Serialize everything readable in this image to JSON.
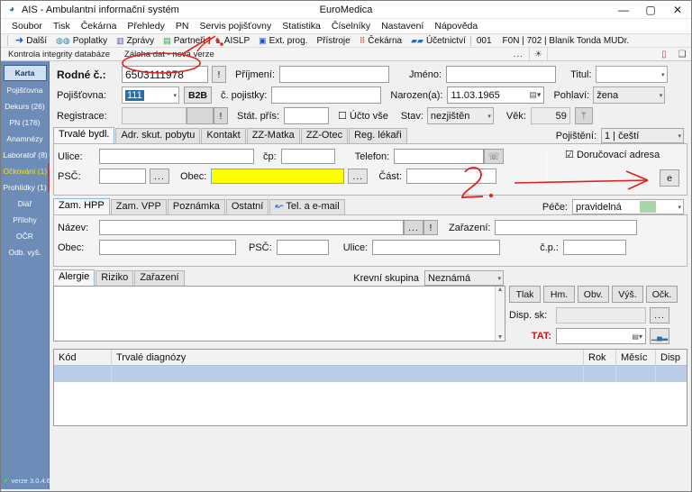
{
  "window": {
    "title_left": "AIS - Ambulantní informační systém",
    "title_center": "EuroMedica",
    "app_icon": "app-icon",
    "minimize": "—",
    "maximize": "▢",
    "close": "✕"
  },
  "menu": {
    "items": [
      "Soubor",
      "Tisk",
      "Čekárna",
      "Přehledy",
      "PN",
      "Servis pojišťovny",
      "Statistika",
      "Číselníky",
      "Nastavení",
      "Nápověda"
    ]
  },
  "toolbar": {
    "buttons": [
      {
        "label": "Další",
        "icon": "arrow-right-icon",
        "glyph": "➜",
        "color": "#2050c0"
      },
      {
        "label": "Poplatky",
        "icon": "coins-icon",
        "glyph": "◍◍",
        "color": "#2a8aa0"
      },
      {
        "label": "Zprávy",
        "icon": "messages-icon",
        "glyph": "▥",
        "color": "#6a4a9a"
      },
      {
        "label": "Partneři",
        "icon": "partners-icon",
        "glyph": "▤",
        "color": "#2a9a4a"
      },
      {
        "label": "AISLP",
        "icon": "aislp-icon",
        "glyph": "♞",
        "color": "#b03030"
      },
      {
        "label": "Ext. prog.",
        "icon": "external-program-icon",
        "glyph": "▣",
        "color": "#2050c0"
      },
      {
        "label": "Přístroje",
        "icon": "devices-icon",
        "glyph": "",
        "color": "#444444"
      },
      {
        "label": "Čekárna",
        "icon": "waiting-room-icon",
        "glyph": "⠿",
        "color": "#c03030"
      },
      {
        "label": "Účetnictví",
        "icon": "accounting-icon",
        "glyph": "▰▰",
        "color": "#2a6ea8"
      }
    ],
    "code": "001",
    "user": "F0N | 702 | Blaník Tonda MUDr."
  },
  "status_strip": {
    "items": [
      "Kontrola integrity databáze",
      "Záloha dat - nová verze"
    ],
    "dots": "...",
    "sun_icon": "brightness-icon",
    "sun_glyph": "☀",
    "chart_icon": "chart-icon",
    "chart_glyph": "▯",
    "window_icon": "window-icon",
    "window_glyph": "❑"
  },
  "sidebar": {
    "items": [
      {
        "label": "Karta",
        "state": "active"
      },
      {
        "label": "Pojišťovna",
        "state": "normal"
      },
      {
        "label": "Dekurs (26)",
        "state": "normal"
      },
      {
        "label": "PN (176)",
        "state": "normal"
      },
      {
        "label": "Anamnézy",
        "state": "normal"
      },
      {
        "label": "Laboratoř (8)",
        "state": "normal"
      },
      {
        "label": "Očkování (1)",
        "state": "highlight"
      },
      {
        "label": "Prohlídky (1)",
        "state": "normal"
      },
      {
        "label": "Diář",
        "state": "normal"
      },
      {
        "label": "Přílohy",
        "state": "normal"
      },
      {
        "label": "OČR",
        "state": "normal"
      },
      {
        "label": "Odb. vyš.",
        "state": "normal"
      }
    ],
    "version": "verze 3.0.4.6",
    "version_check": "✔"
  },
  "patient": {
    "rodne_cislo_label": "Rodné č.:",
    "rodne_cislo_value": "6503111978",
    "rodne_cislo_bang": "!",
    "prijmeni_label": "Příjmení:",
    "prijmeni_value": "",
    "jmeno_label": "Jméno:",
    "jmeno_value": "",
    "titul_label": "Titul:",
    "titul_value": "",
    "pojistovna_label": "Pojišťovna:",
    "pojistovna_value": "111",
    "b2b_label": "B2B",
    "c_pojistky_label": "č. pojistky:",
    "c_pojistky_value": "",
    "narozen_label": "Narozen(a):",
    "narozen_value": "11.03.1965",
    "pohlavi_label": "Pohlaví:",
    "pohlavi_value": "žena",
    "registrace_label": "Registrace:",
    "registrace_value": "",
    "registrace_bang": "!",
    "stat_pris_label": "Stát. přís:",
    "stat_pris_value": "",
    "ucto_vse_label": "Účto vše",
    "ucto_vse_checked": "☐",
    "stav_label": "Stav:",
    "stav_value": "nezjištěn",
    "vek_label": "Věk:",
    "vek_value": "59",
    "vek_icon": "person-stats-icon",
    "vek_glyph": "ᛘ"
  },
  "address": {
    "tabs": [
      {
        "label": "Trvalé bydl.",
        "active": true
      },
      {
        "label": "Adr. skut. pobytu",
        "active": false
      },
      {
        "label": "Kontakt",
        "active": false
      },
      {
        "label": "ZZ-Matka",
        "active": false
      },
      {
        "label": "ZZ-Otec",
        "active": false
      },
      {
        "label": "Reg. lékaři",
        "active": false
      }
    ],
    "pojisteni_label": "Pojištění:",
    "pojisteni_value": "1 | čeští",
    "ulice_label": "Ulice:",
    "ulice_value": "",
    "cp_label": "čp:",
    "cp_value": "",
    "telefon_label": "Telefon:",
    "telefon_value": "",
    "telefon_btn_icon": "phone-icon",
    "telefon_btn_glyph": "☏",
    "psc_label": "PSČ:",
    "psc_value": "",
    "psc_dots": "...",
    "obec_label": "Obec:",
    "obec_value": "",
    "obec_dots": "...",
    "cast_label": "Část:",
    "cast_value": "",
    "dorucovaci_label": "Doručovací adresa",
    "dorucovaci_checked": "☑",
    "e_button_label": "e"
  },
  "employment": {
    "tabs": [
      {
        "label": "Zam. HPP",
        "active": true
      },
      {
        "label": "Zam. VPP",
        "active": false
      },
      {
        "label": "Poznámka",
        "active": false
      },
      {
        "label": "Ostatní",
        "active": false
      },
      {
        "label": "Tel. a e-mail",
        "active": false,
        "icon": "link-icon",
        "glyph": "↜"
      }
    ],
    "pece_label": "Péče:",
    "pece_value": "pravidelná",
    "pece_swatch": "#a8d5a8",
    "nazev_label": "Název:",
    "nazev_value": "",
    "nazev_dots": "...",
    "nazev_bang": "!",
    "zarazeni_label": "Zařazení:",
    "zarazeni_value": "",
    "obec_label": "Obec:",
    "obec_value": "",
    "psc_label": "PSČ:",
    "psc_value": "",
    "ulice_label": "Ulice:",
    "ulice_value": "",
    "cp_label": "č.p.:",
    "cp_value": ""
  },
  "allergy": {
    "tabs": [
      {
        "label": "Alergie",
        "active": true
      },
      {
        "label": "Riziko",
        "active": false
      },
      {
        "label": "Zařazení",
        "active": false
      }
    ],
    "krevni_skupina_label": "Krevní skupina",
    "krevni_skupina_value": "Neznámá",
    "text_value": ""
  },
  "measures": {
    "buttons": [
      "Tlak",
      "Hm.",
      "Obv.",
      "Výš.",
      "Očk."
    ],
    "disp_sk_label": "Disp. sk:",
    "disp_sk_value": "",
    "disp_sk_dots": "...",
    "tat_label": "TAT:",
    "tat_value": "",
    "tat_color": "#e01010",
    "tat_chart_icon": "bar-chart-icon",
    "tat_chart_glyph": "▁▄▂"
  },
  "diagnoses": {
    "columns": [
      "Kód",
      "Trvalé diagnózy",
      "Rok",
      "Měsíc",
      "Disp"
    ],
    "rows": [
      {
        "kod": "",
        "diagnoza": "",
        "rok": "",
        "mesic": "",
        "disp": ""
      }
    ]
  },
  "annotations": {
    "color": "#e02020",
    "marks": [
      "circle-around-rodne-cislo",
      "arrow-to-toolbar",
      "digit-2-near-cast",
      "arrow-to-e-button"
    ]
  }
}
